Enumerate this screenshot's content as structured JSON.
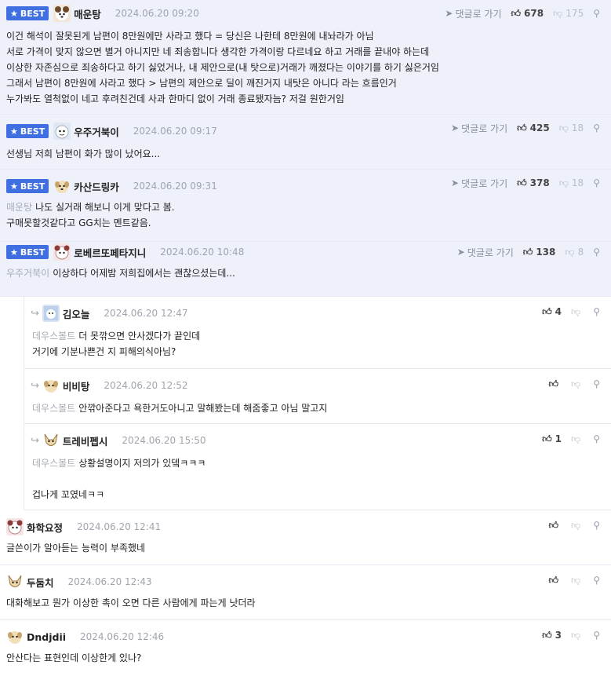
{
  "labels": {
    "best": "BEST",
    "reply_link": "댓글로 가기"
  },
  "comments": [
    {
      "nick": "매운탕",
      "date": "2024.06.20 09:20",
      "up": "678",
      "down": "175",
      "lines": [
        "이건 해석이 잘못된게 남편이 8만원에만 사라고 했다 = 당신은 나한테 8만원에 내놔라가 아님",
        "서로 가격이 맞지 않으면 별거 아니지만 네 죄송합니다 생각한 가격이랑 다르네요 하고 거래를 끝내야 하는데",
        "이상한 자존심으로 죄송하다고 하기 싫었거나, 내 제안으로(내 탓으로)거래가 깨졌다는 이야기를 하기 싫은거임",
        "그래서 남편이 8만원에 사라고 했다 > 남편의 제안으로 딜이 깨진거지 내탓은 아니다 라는 흐름인거",
        "누가봐도 열척없이 네고 후려친건데 사과 한마디 없이 거래 종료됐자늠? 저걸 원한거임"
      ]
    },
    {
      "nick": "우주거북이",
      "date": "2024.06.20 09:17",
      "up": "425",
      "down": "18",
      "lines": [
        "선생님 저희 남편이 화가 많이 났어요..."
      ]
    },
    {
      "nick": "카산드링카",
      "date": "2024.06.20 09:31",
      "up": "378",
      "down": "18",
      "mention": "매운탕",
      "lines": [
        "나도 실거래 해보니 이게 맞다고 봄.",
        "구매못할것같다고 GG치는 멘트같음."
      ]
    },
    {
      "nick": "로베르또페타지니",
      "date": "2024.06.20 10:48",
      "up": "138",
      "down": "8",
      "mention": "우주거북이",
      "lines": [
        "이상하다 어제밤 저희집에서는 괜찮으셨는데..."
      ]
    },
    {
      "nick": "김오늘",
      "date": "2024.06.20 12:47",
      "up": "4",
      "down": "",
      "mention": "데우스볼트",
      "lines": [
        "더 못깎으면 안사겠다가 끝인데",
        "거기에 기분나쁜건 지 피해의식아님?"
      ]
    },
    {
      "nick": "비비탕",
      "date": "2024.06.20 12:52",
      "up": "",
      "down": "",
      "mention": "데우스볼트",
      "lines": [
        "안깎아준다고 욕한거도아니고 말해봤는데 해줌좋고 아님 말고지"
      ]
    },
    {
      "nick": "트레비펩시",
      "date": "2024.06.20 15:50",
      "up": "1",
      "down": "",
      "mention": "데우스볼트",
      "lines": [
        "상황설명이지 저의가 있뎈ㅋㅋㅋ",
        "",
        "겁나게 꼬였네ㅋㅋ"
      ]
    },
    {
      "nick": "화학요정",
      "date": "2024.06.20 12:41",
      "up": "",
      "down": "",
      "lines": [
        "글쓴이가 알아듣는 능력이 부족했네"
      ]
    },
    {
      "nick": "두둠치",
      "date": "2024.06.20 12:43",
      "up": "",
      "down": "",
      "lines": [
        "대화해보고 뭔가 이상한 촉이 오면 다른 사람에게 파는게 낫더라"
      ]
    },
    {
      "nick": "Dndjdii",
      "date": "2024.06.20 12:46",
      "up": "3",
      "down": "",
      "lines": [
        "안산다는 표현인데 이상한게 있나?"
      ]
    }
  ],
  "icons": {
    "star": "star-icon",
    "reply": "reply-arrow-icon",
    "thumb_up": "thumbs-up-icon",
    "thumb_down": "thumbs-down-icon",
    "share": "share-icon",
    "indent": "reply-indent-icon"
  },
  "colors": {
    "best_badge": "#3f6fe0",
    "best_bg": "#eef1fa",
    "mention": "#a8acb4",
    "date": "#a0a4ad"
  }
}
